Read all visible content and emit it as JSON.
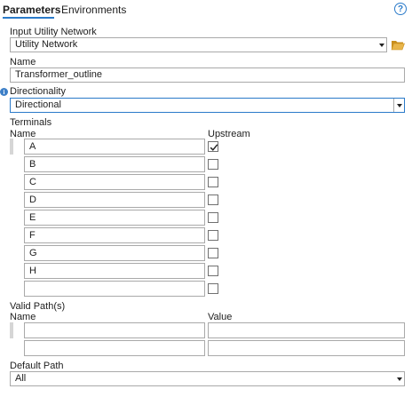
{
  "tabs": [
    {
      "label": "Parameters",
      "active": true
    },
    {
      "label": "Environments",
      "active": false
    }
  ],
  "help_icon": "?",
  "input_utility_network": {
    "label": "Input Utility Network",
    "value": "Utility Network"
  },
  "name": {
    "label": "Name",
    "value": "Transformer_outline"
  },
  "directionality": {
    "label": "Directionality",
    "value": "Directional",
    "info_glyph": "i"
  },
  "terminals": {
    "label": "Terminals",
    "col_name": "Name",
    "col_upstream": "Upstream",
    "rows": [
      {
        "name": "A",
        "upstream": true
      },
      {
        "name": "B",
        "upstream": false
      },
      {
        "name": "C",
        "upstream": false
      },
      {
        "name": "D",
        "upstream": false
      },
      {
        "name": "E",
        "upstream": false
      },
      {
        "name": "F",
        "upstream": false
      },
      {
        "name": "G",
        "upstream": false
      },
      {
        "name": "H",
        "upstream": false
      },
      {
        "name": "",
        "upstream": false
      }
    ]
  },
  "valid_paths": {
    "label": "Valid Path(s)",
    "col_name": "Name",
    "col_value": "Value",
    "rows": [
      {
        "name": "",
        "value": ""
      },
      {
        "name": "",
        "value": ""
      }
    ]
  },
  "default_path": {
    "label": "Default Path",
    "value": "All"
  },
  "colors": {
    "accent": "#2a7ac9",
    "info": "#3d7fc7",
    "folder": "#e8b54a"
  }
}
